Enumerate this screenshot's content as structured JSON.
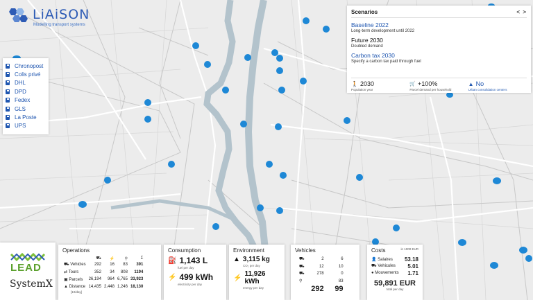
{
  "logo": {
    "name": "LiAiSON",
    "tagline": "Modelling transport systems"
  },
  "carriers": [
    "Chronopost",
    "Colis privé",
    "DHL",
    "DPD",
    "Fedex",
    "GLS",
    "La Poste",
    "UPS"
  ],
  "scenarios": {
    "title": "Scenarios",
    "nav": "< >",
    "items": [
      {
        "name": "Baseline 2022",
        "desc": "Long-term development until 2022"
      },
      {
        "name": "Future 2030",
        "desc": "Doubled demand"
      },
      {
        "name": "Carbon tax 2030",
        "desc": "Specify a carbon tax paid through fuel"
      }
    ],
    "params": [
      {
        "value": "2030",
        "label": "Population year"
      },
      {
        "value": "+100%",
        "label": "Parcel demand per household"
      },
      {
        "value": "No",
        "label": "Urban consolidation centers"
      }
    ]
  },
  "partners": {
    "lead": "LEAD",
    "systemx": "SystemX"
  },
  "operations": {
    "title": "Operations",
    "rows": [
      {
        "label": "Vehicles",
        "v": [
          "292",
          "16",
          "83",
          "391"
        ]
      },
      {
        "label": "Tours",
        "v": [
          "352",
          "34",
          "808",
          "1194"
        ]
      },
      {
        "label": "Parcels",
        "v": [
          "26,194",
          "964",
          "6,765",
          "33,923"
        ]
      },
      {
        "label": "Distance",
        "v": [
          "14,435",
          "2,448",
          "1,246",
          "18,130"
        ]
      }
    ],
    "note": "[10/day]",
    "sum_symbol": "Σ"
  },
  "consumption": {
    "title": "Consumption",
    "fuel": "1,143 L",
    "fuel_label": "fuel per day",
    "elec": "499 kWh",
    "elec_label": "electricity per day"
  },
  "environment": {
    "title": "Environment",
    "co2": "3,115 kg",
    "co2_label": "CO₂ per day",
    "energy": "11,926 kWh",
    "energy_label": "energy per day"
  },
  "vehicles": {
    "title": "Vehicles",
    "rows": [
      [
        "2",
        "6"
      ],
      [
        "12",
        "10"
      ],
      [
        "278",
        "0"
      ],
      [
        "",
        "83"
      ]
    ],
    "totals": [
      "292",
      "99"
    ]
  },
  "costs": {
    "title": "Costs",
    "unit": "in 1000 EUR",
    "rows": [
      {
        "label": "Salaires",
        "value": "53.18"
      },
      {
        "label": "Vehicules",
        "value": "5.01"
      },
      {
        "label": "Mouvements",
        "value": "1.71"
      }
    ],
    "total": "59,891 EUR",
    "total_label": "total per day"
  },
  "colors": {
    "accent": "#1f56b0",
    "marker": "#1e88d6",
    "river": "#b3c3cc",
    "road": "#ffffff"
  }
}
